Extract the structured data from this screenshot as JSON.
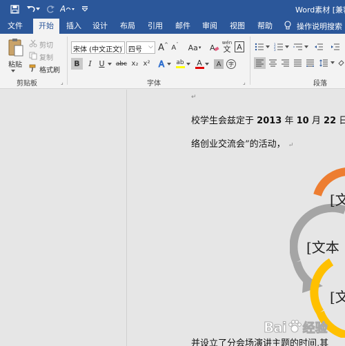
{
  "app": {
    "title": "Word素材 [兼容"
  },
  "tabs": [
    {
      "label": "文件"
    },
    {
      "label": "开始"
    },
    {
      "label": "插入"
    },
    {
      "label": "设计"
    },
    {
      "label": "布局"
    },
    {
      "label": "引用"
    },
    {
      "label": "邮件"
    },
    {
      "label": "审阅"
    },
    {
      "label": "视图"
    },
    {
      "label": "帮助"
    }
  ],
  "tell_me": "操作说明搜索",
  "clipboard": {
    "paste": "粘贴",
    "cut": "剪切",
    "copy": "复制",
    "format_painter": "格式刷",
    "group_label": "剪贴板"
  },
  "font": {
    "font_name": "宋体 (中文正文)",
    "font_size": "四号",
    "grow": "A",
    "shrink": "A",
    "change_case": "Aa",
    "wen": "wén",
    "wen_char": "文",
    "boxed_a": "A",
    "bold": "B",
    "italic": "I",
    "underline": "U",
    "strikethrough": "abc",
    "subscript": "x₂",
    "superscript": "x²",
    "text_effects": "A",
    "highlight": "ab",
    "font_color": "A",
    "shading": "A",
    "enclose": "字",
    "group_label": "字体"
  },
  "paragraph": {
    "group_label": "段落"
  },
  "document": {
    "line1_a": "校学生会兹定于",
    "line1_b": "2013",
    "line1_c": "年",
    "line1_d": "10",
    "line1_e": "月",
    "line1_f": "22",
    "line1_g": "日",
    "line2": "络创业交流会”的活动，",
    "line3": "并设立了分会场演讲主题的时间,其",
    "para_mark": "↵"
  },
  "smartart": {
    "item1": "[文",
    "item2": "[文本",
    "item3": "[文"
  },
  "watermark": {
    "text": "Bai",
    "text2": "经验"
  },
  "colors": {
    "ribbon_blue": "#2b579a",
    "orange": "#ed7d31",
    "gray": "#a5a5a5",
    "gold": "#ffc000",
    "font_red": "#e00000",
    "highlight_yellow": "#ffff00"
  }
}
